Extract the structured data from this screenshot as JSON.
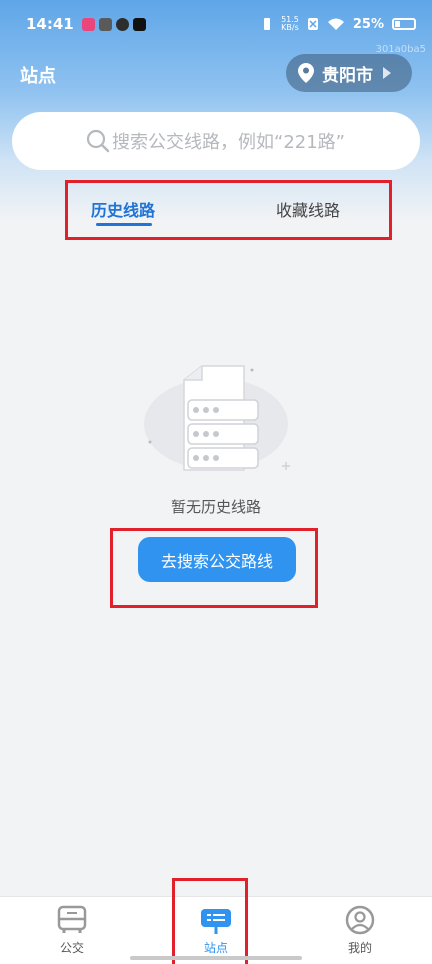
{
  "status": {
    "time": "14:41",
    "net_speed_top": "51.5",
    "net_speed_bottom": "KB/s",
    "battery": "25%"
  },
  "header": {
    "title": "站点",
    "city": "贵阳市",
    "tag_id": "301a0ba5"
  },
  "search": {
    "placeholder": "搜索公交线路，例如“221路”"
  },
  "tabs": [
    {
      "label": "历史线路",
      "active": true
    },
    {
      "label": "收藏线路",
      "active": false
    }
  ],
  "empty": {
    "message": "暂无历史线路",
    "cta": "去搜索公交路线"
  },
  "tabbar": [
    {
      "label": "公交",
      "icon": "bus-icon"
    },
    {
      "label": "站点",
      "icon": "station-icon",
      "active": true
    },
    {
      "label": "我的",
      "icon": "profile-icon"
    }
  ],
  "colors": {
    "accent": "#2f93ef",
    "highlight_box": "#e0202a",
    "header_blue": "#5fa6e8"
  }
}
